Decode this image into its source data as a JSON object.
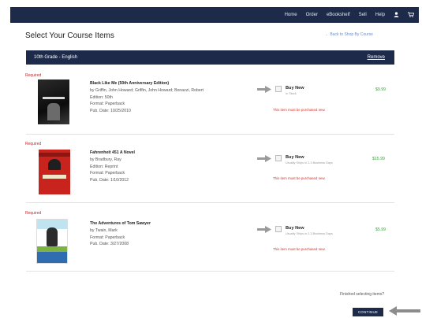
{
  "nav": {
    "items": [
      "Home",
      "Order",
      "eBookshelf",
      "Sell",
      "Help"
    ],
    "icons": [
      "user-icon",
      "cart-icon"
    ]
  },
  "page_title": "Select Your Course Items",
  "back_link": "← Back to Shop By Course",
  "course": {
    "title": "10th Grade - English",
    "remove_label": "Remove"
  },
  "items": [
    {
      "required": "Required",
      "title": "Black Like Me (50th Anniversary Edition)",
      "author": "by Griffin, John Howard; Griffin, John Howard; Bonazzi, Robert",
      "edition": "Edition: 50th",
      "format": "Format: Paperback",
      "pub_date": "Pub. Date: 10/25/2010",
      "buy_label": "Buy New",
      "stock": "In Stock",
      "must_note": "This item must be purchased new.",
      "price": "$9.99"
    },
    {
      "required": "Required",
      "title": "Fahrenheit 451 A Novel",
      "author": "by Bradbury, Ray",
      "edition": "Edition: Reprint",
      "format": "Format: Paperback",
      "pub_date": "Pub. Date: 1/10/2012",
      "buy_label": "Buy New",
      "stock": "Usually Ships in 2-3 Business Days",
      "must_note": "This item must be purchased new.",
      "price": "$15.99"
    },
    {
      "required": "Required",
      "title": "The Adventures of Tom Sawyer",
      "author": "by Twain, Mark",
      "format": "Format: Paperback",
      "pub_date": "Pub. Date: 3/27/2008",
      "buy_label": "Buy New",
      "stock": "Usually Ships in 2-3 Business Days",
      "must_note": "This item must be purchased new.",
      "price": "$5.99"
    }
  ],
  "footer": {
    "finished_label": "Finished selecting items?",
    "continue_label": "CONTINUE"
  },
  "colors": {
    "navy": "#1e2a4a",
    "required_red": "#c0282d",
    "price_green": "#3aa53a",
    "link_blue": "#6b8fc9"
  }
}
